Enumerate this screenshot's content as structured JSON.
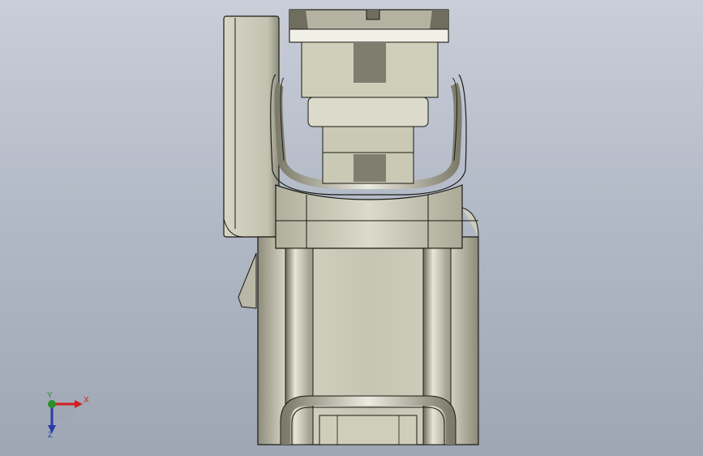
{
  "app": {
    "view": "graphics-area"
  },
  "colors": {
    "background_top": "#c9ced8",
    "background_bottom": "#9ea6b4",
    "part_light": "#d8d7c7",
    "part_mid": "#b5b4a2",
    "part_dark": "#6f6d5e",
    "edge": "#1a1a14",
    "axis_x": "#d21e1e",
    "axis_y": "#2b8f2b",
    "axis_z": "#2a3aa8"
  },
  "triad": {
    "x_label": "X",
    "y_label": "Y",
    "z_label": "Z"
  }
}
